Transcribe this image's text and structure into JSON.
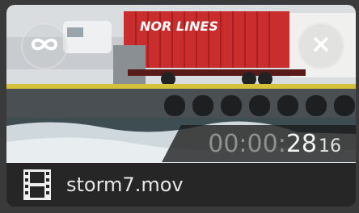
{
  "clip": {
    "filename": "storm7.mov",
    "timecode": {
      "dim": "00:00:",
      "seconds": "28",
      "frames": "16"
    },
    "container_text": "NOR LINES",
    "icons": {
      "loop": "infinity-loop-icon",
      "close": "close-x-icon",
      "file": "film-strip-icon"
    }
  }
}
